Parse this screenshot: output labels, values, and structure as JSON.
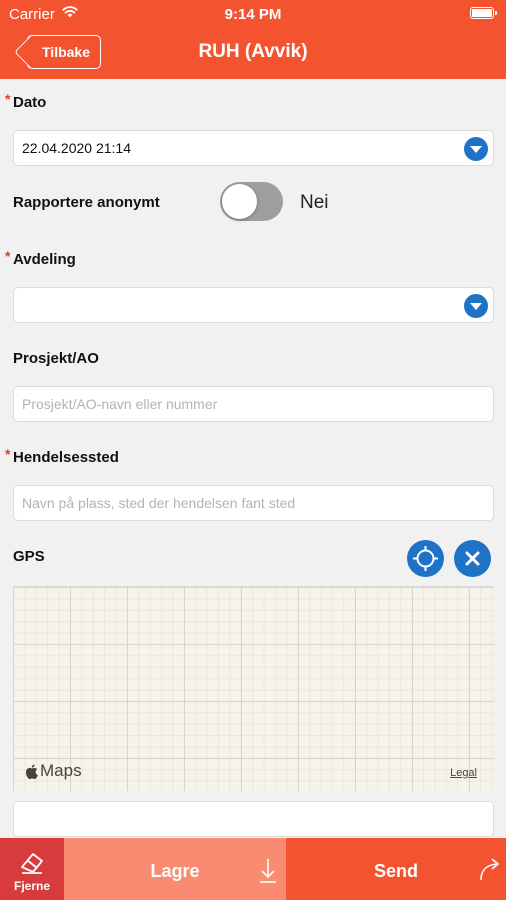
{
  "status_bar": {
    "carrier": "Carrier",
    "time": "9:14 PM"
  },
  "header": {
    "back_label": "Tilbake",
    "title": "RUH (Avvik)"
  },
  "form": {
    "required_marker": "*",
    "dato": {
      "label": "Dato",
      "value": "22.04.2020 21:14"
    },
    "anonymous": {
      "label": "Rapportere anonymt",
      "value": "Nei",
      "on": false
    },
    "avdeling": {
      "label": "Avdeling",
      "value": ""
    },
    "prosjekt": {
      "label": "Prosjekt/AO",
      "placeholder": "Prosjekt/AO-navn eller nummer"
    },
    "hendelsessted": {
      "label": "Hendelsessted",
      "placeholder": "Navn på plass, sted der hendelsen fant sted"
    },
    "gps": {
      "label": "GPS",
      "value": ""
    }
  },
  "map": {
    "brand": "Maps",
    "legal": "Legal"
  },
  "bottom_bar": {
    "fjerne_label": "Fjerne",
    "lagre_label": "Lagre",
    "send_label": "Send"
  },
  "colors": {
    "header": "#f4532f",
    "accent_blue": "#1e73c6",
    "fjerne": "#d83b3b",
    "lagre": "#f88b70",
    "send": "#f4532f"
  }
}
